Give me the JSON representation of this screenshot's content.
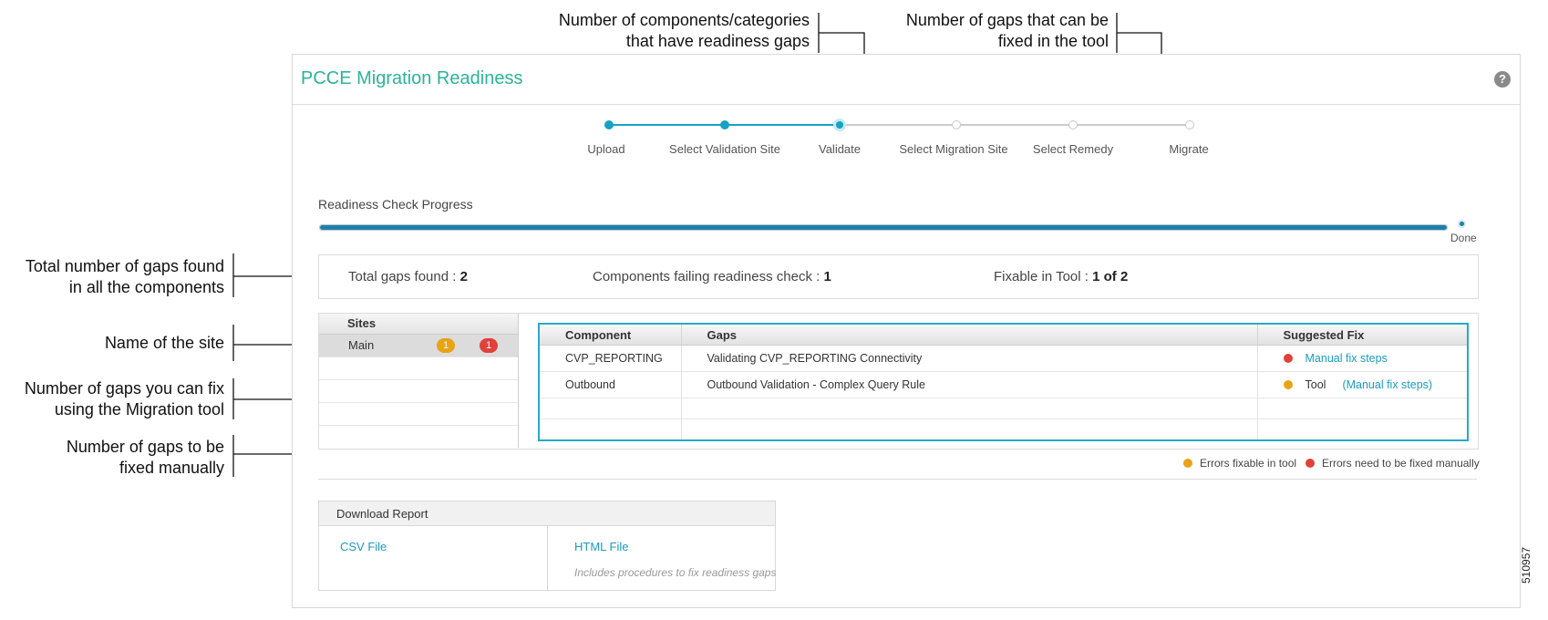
{
  "callouts": {
    "components_failing": [
      "Number of components/categories",
      "that have readiness gaps"
    ],
    "fixable_in_tool": [
      "Number of gaps that can be",
      "fixed in the tool"
    ],
    "total_gaps": [
      "Total number of gaps found",
      "in all the components"
    ],
    "site_name": [
      "Name of the site"
    ],
    "gaps_fix_tool": [
      "Number of gaps you can fix",
      "using the Migration tool"
    ],
    "gaps_manual": [
      "Number of gaps to be",
      "fixed manually"
    ]
  },
  "panel": {
    "title": "PCCE Migration Readiness",
    "help_icon": "question-icon",
    "help_glyph": "?"
  },
  "stepper": {
    "steps": [
      {
        "label": "Upload",
        "state": "done"
      },
      {
        "label": "Select Validation Site",
        "state": "done"
      },
      {
        "label": "Validate",
        "state": "current"
      },
      {
        "label": "Select Migration Site",
        "state": "todo"
      },
      {
        "label": "Select Remedy",
        "state": "todo"
      },
      {
        "label": "Migrate",
        "state": "todo"
      }
    ]
  },
  "progress": {
    "label": "Readiness Check Progress",
    "percent": 100,
    "status": "Done"
  },
  "summary": {
    "total_label": "Total gaps found : ",
    "total_value": "2",
    "components_label": "Components failing readiness check : ",
    "components_value": "1",
    "fixable_label": "Fixable in Tool : ",
    "fixable_value": "1 of 2"
  },
  "sites": {
    "header": "Sites",
    "rows": [
      {
        "name": "Main",
        "fixable_in_tool": "1",
        "fix_manually": "1"
      }
    ]
  },
  "gaps_table": {
    "columns": [
      "Component",
      "Gaps",
      "Suggested Fix"
    ],
    "rows": [
      {
        "component": "CVP_REPORTING",
        "gap": "Validating CVP_REPORTING Connectivity",
        "fix_type": "manual",
        "fix_text": "",
        "fix_link": "Manual fix steps"
      },
      {
        "component": "Outbound",
        "gap": "Outbound Validation - Complex Query Rule",
        "fix_type": "tool",
        "fix_text": "Tool",
        "fix_link": "(Manual fix steps)"
      }
    ]
  },
  "legend": {
    "tool": "Errors fixable in tool",
    "manual": "Errors need to be fixed manually"
  },
  "download": {
    "header": "Download Report",
    "csv": "CSV File",
    "html": "HTML File",
    "html_note": "Includes procedures to fix readiness gaps"
  },
  "figure_id": "510957",
  "colors": {
    "accent": "#2bb39a",
    "step": "#17a2c3",
    "tool": "#e8a317",
    "manual": "#e0413a",
    "link": "#1b9bbf",
    "progress": "#1f7fa8"
  }
}
